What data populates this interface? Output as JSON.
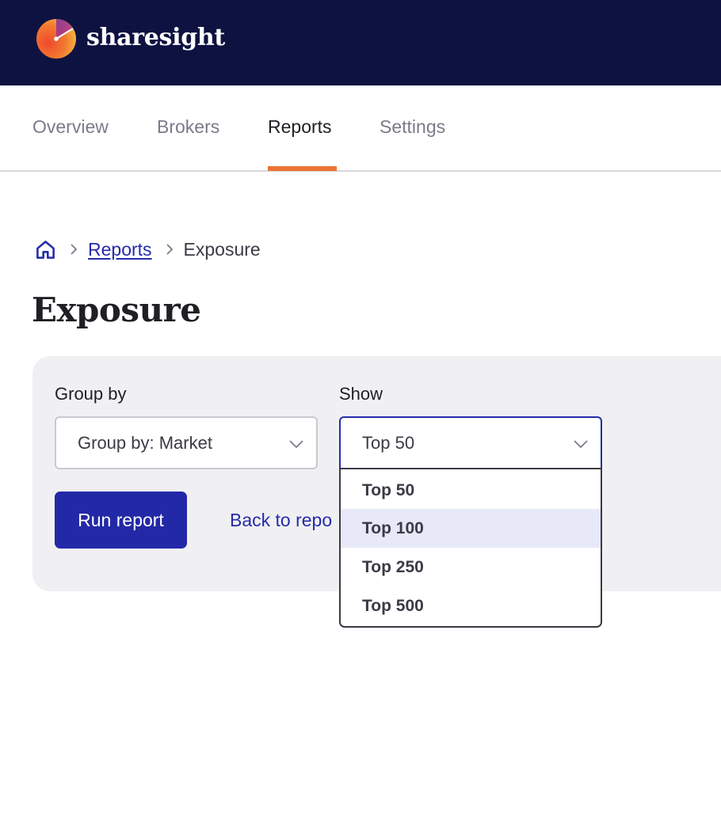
{
  "header": {
    "brand": "sharesight",
    "logo_icon": "sharesight-gauge-logo"
  },
  "nav": {
    "tabs": [
      {
        "label": "Overview",
        "active": false
      },
      {
        "label": "Brokers",
        "active": false
      },
      {
        "label": "Reports",
        "active": true
      },
      {
        "label": "Settings",
        "active": false
      }
    ],
    "accent_color": "#ec7433"
  },
  "breadcrumb": {
    "home_icon": "home-icon",
    "items": [
      {
        "label": "Reports",
        "link": true
      },
      {
        "label": "Exposure",
        "link": false
      }
    ]
  },
  "page": {
    "title": "Exposure"
  },
  "filters": {
    "group_by": {
      "label": "Group by",
      "value": "Group by: Market"
    },
    "show": {
      "label": "Show",
      "value": "Top 50",
      "open": true,
      "options": [
        "Top 50",
        "Top 100",
        "Top 250",
        "Top 500"
      ],
      "highlighted_option": "Top 100"
    },
    "run_button": "Run report",
    "back_link": "Back to repo"
  },
  "colors": {
    "header_bg": "#0e1241",
    "primary": "#2329a6",
    "link": "#252caa",
    "panel_bg": "#f0f0f3",
    "option_highlight": "#e7e8f8"
  }
}
